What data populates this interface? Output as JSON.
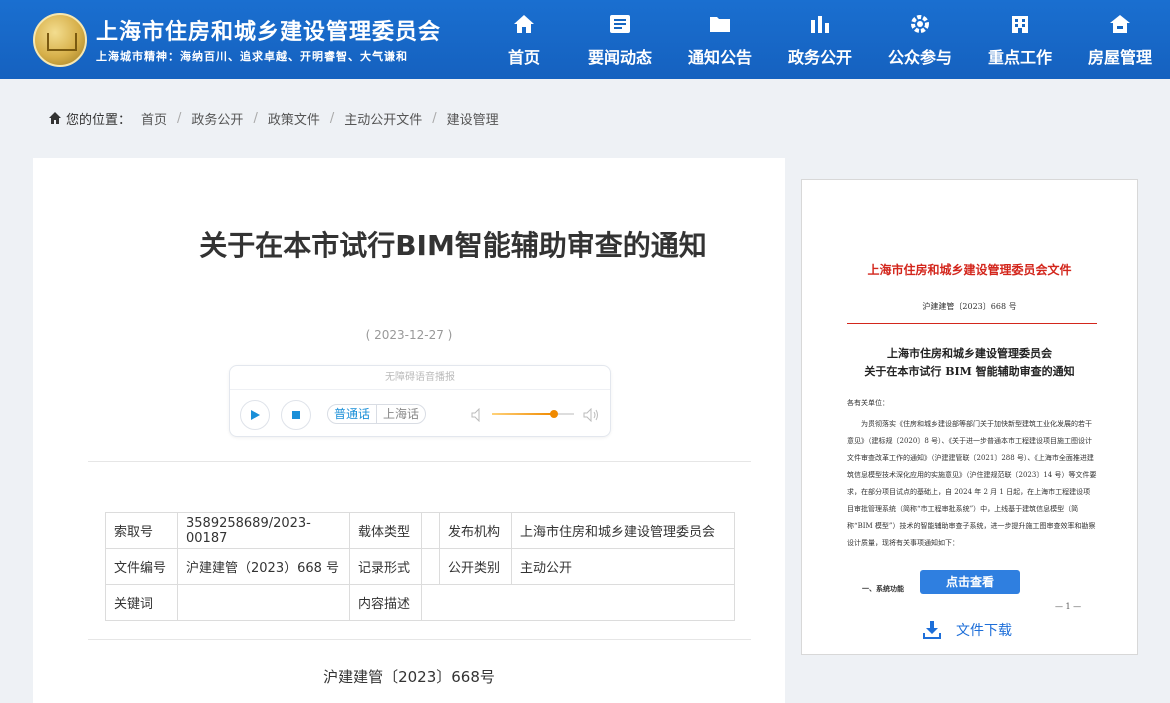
{
  "header": {
    "site_title": "上海市住房和城乡建设管理委员会",
    "motto": "上海城市精神：海纳百川、追求卓越、开明睿智、大气谦和",
    "nav": [
      {
        "label": "首页",
        "icon": "home-icon"
      },
      {
        "label": "要闻动态",
        "icon": "news-icon"
      },
      {
        "label": "通知公告",
        "icon": "folder-icon"
      },
      {
        "label": "政务公开",
        "icon": "chart-icon"
      },
      {
        "label": "公众参与",
        "icon": "gear-icon"
      },
      {
        "label": "重点工作",
        "icon": "building-icon"
      },
      {
        "label": "房屋管理",
        "icon": "house-icon"
      }
    ]
  },
  "breadcrumb": {
    "lead": "您的位置：",
    "items": [
      "首页",
      "政务公开",
      "政策文件",
      "主动公开文件",
      "建设管理"
    ]
  },
  "article": {
    "title": "关于在本市试行BIM智能辅助审查的通知",
    "date": "( 2023-12-27 )",
    "doc_number": "沪建建管〔2023〕668号"
  },
  "player": {
    "title": "无障碍语音播报",
    "lang_a": "普通话",
    "lang_b": "上海话",
    "volume": 0.75
  },
  "meta": {
    "rows": [
      [
        "索取号",
        "3589258689/2023-00187",
        "载体类型",
        "",
        "发布机构",
        "上海市住房和城乡建设管理委员会"
      ],
      [
        "文件编号",
        "沪建建管（2023）668 号",
        "记录形式",
        "",
        "公开类别",
        "主动公开"
      ],
      [
        "关键词",
        "",
        "内容描述",
        "",
        "",
        ""
      ]
    ]
  },
  "preview": {
    "head": "上海市住房和城乡建设管理委员会文件",
    "num": "沪建建管〔2023〕668 号",
    "title1": "上海市住房和城乡建设管理委员会",
    "title2": "关于在本市试行 BIM 智能辅助审查的通知",
    "salute": "各有关单位：",
    "body": "为贯彻落实《住房和城乡建设部等部门关于加快新型建筑工业化发展的若干意见》（建标规〔2020〕8 号）、《关于进一步普通本市工程建设项目施工图设计文件审查改革工作的通知》（沪建建管联〔2021〕288 号）、《上海市全面推进建筑信息模型技术深化应用的实施意见》（沪住建规范联〔2023〕14 号）等文件要求，在部分项目试点的基础上，自 2024 年 2 月 1 日起，在上海市工程建设项目审批管理系统（简称“市工程审批系统”）中，上线基于建筑信息模型（简称“BIM 模型”）技术的智能辅助审查子系统，进一步提升施工图审查效率和勘察设计质量，现将有关事项通知如下：",
    "section": "一、系统功能",
    "page": "— 1 —",
    "view_label": "点击查看",
    "download_label": "文件下载"
  }
}
